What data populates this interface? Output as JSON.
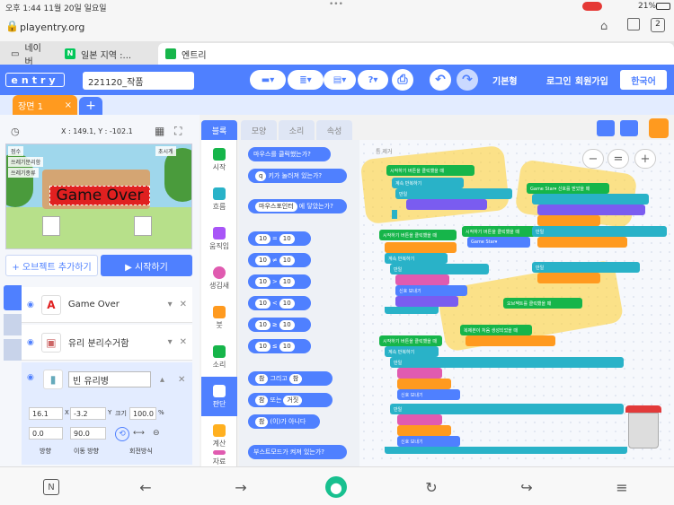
{
  "status_bar": {
    "time_date": "오후 1:44   11월 20일 일요일",
    "battery": "21%"
  },
  "browser": {
    "url": "playentry.org",
    "tab_count": "2",
    "tabs": [
      {
        "label": "네이버"
      },
      {
        "label": "일본 지역 :..."
      },
      {
        "label": "엔트리"
      }
    ]
  },
  "header": {
    "logo": "entry",
    "project_title": "221120_작품",
    "mode": "기본형",
    "login": "로그인",
    "signup": "회원가입",
    "language": "한국어"
  },
  "scene": {
    "tab_label": "장면 1",
    "close": "×",
    "add": "+"
  },
  "stage": {
    "coords": "X : 149.1, Y : -102.1",
    "game_over_text": "Game Over",
    "vars": [
      {
        "label": "점수"
      },
      {
        "label": "쓰레기분리함"
      },
      {
        "label": "쓰레기종류"
      }
    ],
    "top_right_label": "초시계"
  },
  "object_panel": {
    "add_object": "+ 오브젝트 추가하기",
    "start": "▶ 시작하기",
    "objects": [
      {
        "name": "Game Over",
        "thumb": "A"
      },
      {
        "name": "유리 분리수거함",
        "thumb": "▣"
      }
    ],
    "selected": {
      "name": "빈 유리병",
      "x": "16.1",
      "y": "-3.2",
      "size": "100.0",
      "direction": "0.0",
      "move_direction": "90.0",
      "labels": {
        "x_unit": "X",
        "y_unit": "Y",
        "size": "크기",
        "size_unit": "%",
        "direction": "방향",
        "move_direction": "이동 방향",
        "rotation": "회전방식"
      }
    }
  },
  "palette": {
    "tabs": [
      "블록",
      "모양",
      "소리",
      "속성"
    ],
    "categories": [
      "시작",
      "흐름",
      "움직임",
      "생김새",
      "붓",
      "소리",
      "판단",
      "계산",
      "자료",
      ""
    ],
    "blocks": {
      "mouse_clicked": "마우스를 클릭했는가?",
      "key_pressed": "키가 눌러져 있는가?",
      "key": "q",
      "touching": "에 닿았는가?",
      "mouse_pointer": "마우스포인터",
      "num": "10",
      "ops": [
        "=",
        "≠",
        ">",
        "<",
        "≥",
        "≤"
      ],
      "true_val": "참",
      "and": "그리고",
      "or": "또는",
      "false_val": "거짓",
      "not": "(이)가 아니다",
      "boost": "부스트모드가 켜져 있는가?"
    }
  },
  "workspace": {
    "zoom_minus": "−",
    "zoom_reset": "=",
    "zoom_plus": "+",
    "corner": "틈 제거",
    "scripts": {
      "start_a": "시작하기 버튼을 클릭했을 때",
      "repeat": "계속 반복하기",
      "if": "만일",
      "game_star": "Game Star▾",
      "send_signal": "신호 보내기",
      "signal_recv": "Game Star▾ 신호를 받았을 때",
      "clone_start": "복제본이 처음 생성되었을 때",
      "obj_clicked": "오브젝트를 클릭했을 때"
    }
  },
  "colors": {
    "accent": "#4f80ff",
    "scene_tab": "#ff9a1f",
    "highlight": "#ffcd28"
  },
  "bottom_nav": [
    "N",
    "←",
    "→",
    "●",
    "↻",
    "↪",
    "≡"
  ]
}
